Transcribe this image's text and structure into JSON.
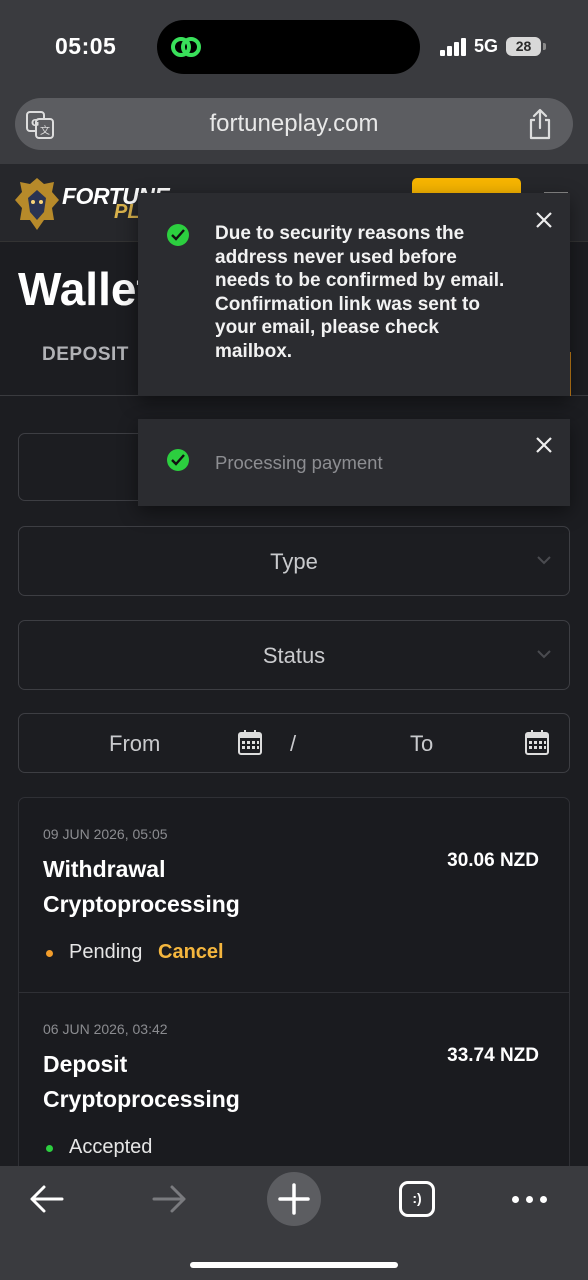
{
  "status_bar": {
    "time": "05:05",
    "network": "5G",
    "battery": "28"
  },
  "browser": {
    "url": "fortuneplay.com"
  },
  "site": {
    "logo_text": "FORTUNE",
    "logo_sub": "PLAY"
  },
  "wallet": {
    "title": "Wallet",
    "tabs": [
      {
        "label": "DEPOSIT"
      }
    ],
    "filters": {
      "type_label": "Type",
      "status_label": "Status",
      "from_label": "From",
      "separator": "/",
      "to_label": "To"
    },
    "transactions": [
      {
        "date": "09 JUN 2026, 05:05",
        "title_line1": "Withdrawal",
        "title_line2": "Cryptoprocessing",
        "amount": "30.06 NZD",
        "status": "Pending",
        "status_color": "#f29d2b",
        "action": "Cancel"
      },
      {
        "date": "06 JUN 2026, 03:42",
        "title_line1": "Deposit",
        "title_line2": "Cryptoprocessing",
        "amount": "33.74 NZD",
        "status": "Accepted",
        "status_color": "#2ccf3f"
      }
    ]
  },
  "toasts": [
    {
      "message_lines": [
        "Due to security reasons the",
        "address never used before",
        "needs to be confirmed by email.",
        "Confirmation link was sent to",
        "your email, please check",
        "mailbox."
      ]
    },
    {
      "message": "Processing payment"
    }
  ],
  "toolbar": {
    "tabs_glyph": ":)"
  },
  "colors": {
    "accent": "#f7b500",
    "success": "#2ccf3f",
    "cancel": "#f4b63e"
  }
}
